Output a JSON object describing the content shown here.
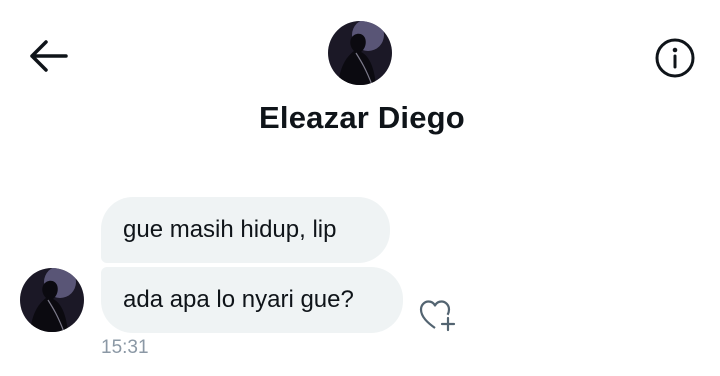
{
  "header": {
    "title": "Eleazar Diego",
    "back_icon": "arrow-left-icon",
    "info_icon": "info-circle-icon"
  },
  "messages": [
    {
      "text": "gue masih hidup, lip"
    },
    {
      "text": "ada apa lo nyari gue?"
    }
  ],
  "message_meta": {
    "timestamp": "15:31",
    "react_icon": "heart-plus-icon"
  },
  "colors": {
    "bubble_bg": "#eff3f4",
    "text": "#0f1419",
    "timestamp": "#8b98a5",
    "avatar_bg": "#1b1826"
  }
}
